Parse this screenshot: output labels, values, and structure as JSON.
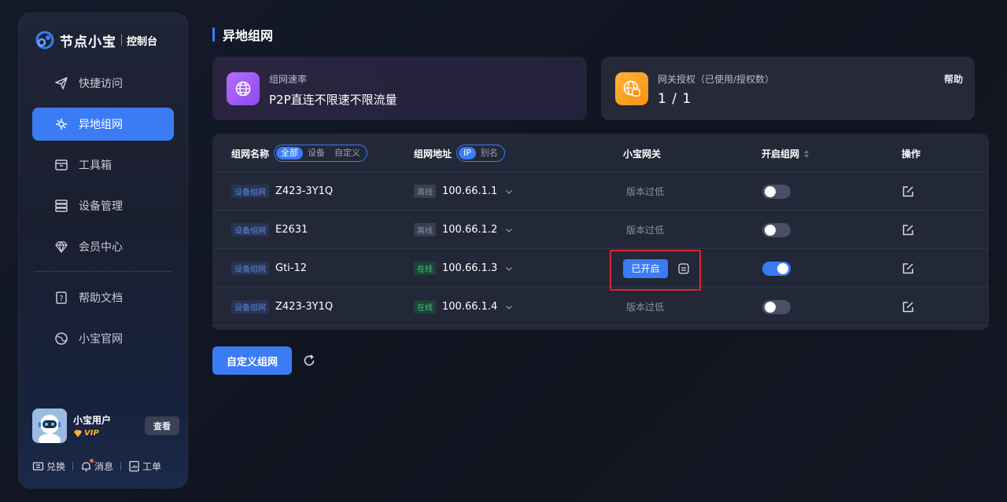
{
  "app": {
    "name": "节点小宝",
    "subtitle": "控制台"
  },
  "sidebar": {
    "items": [
      {
        "label": "快捷访问",
        "icon": "send-icon"
      },
      {
        "label": "异地组网",
        "icon": "network-icon",
        "active": true
      },
      {
        "label": "工具箱",
        "icon": "toolbox-icon"
      },
      {
        "label": "设备管理",
        "icon": "server-icon"
      },
      {
        "label": "会员中心",
        "icon": "diamond-icon"
      },
      {
        "label": "帮助文档",
        "icon": "help-doc-icon"
      },
      {
        "label": "小宝官网",
        "icon": "globe-icon"
      }
    ]
  },
  "user": {
    "name": "小宝用户",
    "badge": "VIP",
    "view_label": "查看"
  },
  "bottom_links": {
    "exchange": "兑换",
    "messages": "消息",
    "tickets": "工单"
  },
  "page": {
    "title": "异地组网"
  },
  "cards": {
    "speed": {
      "label": "组网速率",
      "value": "P2P直连不限速不限流量"
    },
    "gateway": {
      "label": "网关授权（已使用/授权数）",
      "value": "1 / 1",
      "help": "帮助"
    }
  },
  "table": {
    "headers": {
      "name": "组网名称",
      "name_filters": [
        "全部",
        "设备",
        "自定义"
      ],
      "address": "组网地址",
      "address_filters": [
        "IP",
        "别名"
      ],
      "gateway": "小宝网关",
      "enable": "开启组网",
      "action": "操作"
    },
    "rows": [
      {
        "type": "设备组网",
        "name": "Z423-3Y1Q",
        "status": "离线",
        "online": false,
        "ip": "100.66.1.1",
        "gateway": "版本过低",
        "gateway_on": false,
        "enabled": false
      },
      {
        "type": "设备组网",
        "name": "E2631",
        "status": "离线",
        "online": false,
        "ip": "100.66.1.2",
        "gateway": "版本过低",
        "gateway_on": false,
        "enabled": false
      },
      {
        "type": "设备组网",
        "name": "Gti-12",
        "status": "在线",
        "online": true,
        "ip": "100.66.1.3",
        "gateway": "已开启",
        "gateway_on": true,
        "enabled": true
      },
      {
        "type": "设备组网",
        "name": "Z423-3Y1Q",
        "status": "在线",
        "online": true,
        "ip": "100.66.1.4",
        "gateway": "版本过低",
        "gateway_on": false,
        "enabled": false
      }
    ]
  },
  "actions": {
    "custom_network": "自定义组网"
  },
  "colors": {
    "accent": "#3b7cf5",
    "online": "#3fc77f",
    "highlight": "#e0242c",
    "vip": "#f7b33a"
  }
}
